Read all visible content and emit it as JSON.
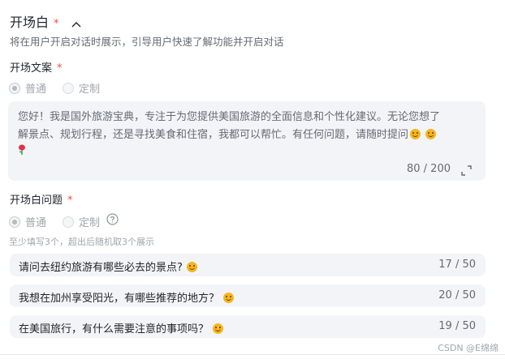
{
  "section": {
    "title": "开场白",
    "required_mark": "*",
    "description": "将在用户开启对话时展示，引导用户快速了解功能并开启对话"
  },
  "opening_text": {
    "label": "开场文案",
    "required_mark": "*",
    "options": [
      "普通",
      "定制"
    ],
    "selected": "普通",
    "content_line1": "您好！我是国外旅游宝典，专注于为您提供美国旅游的全面信息和个性化建议。无论您想了",
    "content_line2": "解景点、规划行程，还是寻找美食和住宿，我都可以帮忙。有任何问题，请随时提问",
    "counter": "80 / 200"
  },
  "opening_questions": {
    "label": "开场白问题",
    "required_mark": "*",
    "options": [
      "普通",
      "定制"
    ],
    "selected": "普通",
    "hint": "至少填写3个，超出后随机取3个展示",
    "items": [
      {
        "text": "请问去纽约旅游有哪些必去的景点?",
        "count": "17 / 50"
      },
      {
        "text": "我想在加州享受阳光，有哪些推荐的地方？",
        "count": "20 / 50"
      },
      {
        "text": "在美国旅行，有什么需要注意的事项吗？",
        "count": "19 / 50"
      }
    ]
  },
  "icons": {
    "collapse": "chevron-up-icon",
    "expand": "expand-icon",
    "help": "question-circle-icon",
    "smile": "smiling-face-emoji",
    "rose": "rose-emoji"
  },
  "colors": {
    "required": "#f54a45",
    "panel_bg": "#f3f4f7",
    "muted_text": "#646a73"
  },
  "watermark": "CSDN @E绵绵"
}
